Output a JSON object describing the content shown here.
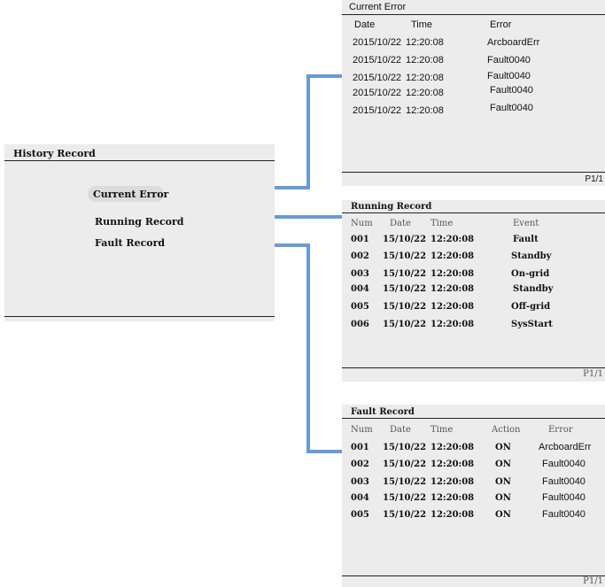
{
  "history": {
    "title": "History Record",
    "items": [
      "Current Error",
      "Running Record",
      "Fault Record"
    ]
  },
  "current_error": {
    "title": "Current Error",
    "headers": [
      "Date",
      "Time",
      "Error"
    ],
    "rows": [
      [
        "2015/10/22",
        "12:20:08",
        "ArcboardErr"
      ],
      [
        "2015/10/22",
        "12:20:08",
        "Fault0040"
      ],
      [
        "2015/10/22",
        "12:20:08",
        "Fault0040"
      ],
      [
        "2015/10/22",
        "12:20:08",
        "Fault0040"
      ],
      [
        "2015/10/22",
        "12:20:08",
        "Fault0040"
      ]
    ],
    "page": "P1/1"
  },
  "running_record": {
    "title": "Running Record",
    "headers": [
      "Num",
      "Date",
      "Time",
      "Event"
    ],
    "rows": [
      [
        "001",
        "15/10/22",
        "12:20:08",
        "Fault"
      ],
      [
        "002",
        "15/10/22",
        "12:20:08",
        "Standby"
      ],
      [
        "003",
        "15/10/22",
        "12:20:08",
        "On-grid"
      ],
      [
        "004",
        "15/10/22",
        "12:20:08",
        "Standby"
      ],
      [
        "005",
        "15/10/22",
        "12:20:08",
        "Off-grid"
      ],
      [
        "006",
        "15/10/22",
        "12:20:08",
        "SysStart"
      ]
    ],
    "page": "P1/1"
  },
  "fault_record": {
    "title": "Fault Record",
    "headers": [
      "Num",
      "Date",
      "Time",
      "Action",
      "Error"
    ],
    "rows": [
      [
        "001",
        "15/10/22",
        "12:20:08",
        "ON",
        "ArcboardErr"
      ],
      [
        "002",
        "15/10/22",
        "12:20:08",
        "ON",
        "Fault0040"
      ],
      [
        "003",
        "15/10/22",
        "12:20:08",
        "ON",
        "Fault0040"
      ],
      [
        "004",
        "15/10/22",
        "12:20:08",
        "ON",
        "Fault0040"
      ],
      [
        "005",
        "15/10/22",
        "12:20:08",
        "ON",
        "Fault0040"
      ]
    ],
    "page": "P1/1"
  },
  "colors": {
    "panel": "#ececec",
    "connector": "#6a9ad6",
    "line": "#222222"
  }
}
